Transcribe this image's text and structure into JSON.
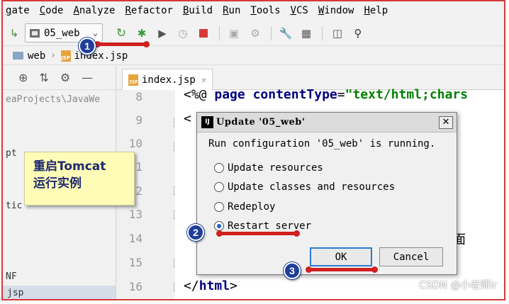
{
  "menubar": {
    "items": [
      "gate",
      "Code",
      "Analyze",
      "Refactor",
      "Build",
      "Run",
      "Tools",
      "VCS",
      "Window",
      "Help"
    ]
  },
  "toolbar": {
    "run_config": "05_web",
    "icons": [
      "rerun-icon",
      "debug-icon",
      "coverage-icon",
      "profile-icon",
      "stop-icon",
      "build-icon",
      "deploy-icon",
      "settings-wrench-icon",
      "project-structure-icon",
      "terminal-icon",
      "search-icon"
    ]
  },
  "breadcrumb": {
    "folder": "web",
    "file": "index.jsp"
  },
  "sidebar": {
    "lines": [
      "eaProjects\\JavaWe",
      "pt",
      "tic",
      "NF",
      "jsp"
    ]
  },
  "editor": {
    "tab_label": "index.jsp",
    "line_numbers": [
      "8",
      "9",
      "10",
      "11",
      "12",
      "13",
      "14",
      "15",
      "16"
    ],
    "line8_prefix": "<%@ ",
    "line8_kw1": "page",
    "line8_kw2": "contentType",
    "line8_eq": "=",
    "line8_str": "\"text/html;chars",
    "line9": "<",
    "line14_tail": "面",
    "line16_open": "</",
    "line16_tag": "html",
    "line16_close": ">"
  },
  "note": {
    "line1": "重启Tomcat",
    "line2": "运行实例"
  },
  "dialog": {
    "title": "Update '05_web'",
    "message": "Run configuration '05_web' is running.",
    "options": [
      "Update resources",
      "Update classes and resources",
      "Redeploy",
      "Restart server"
    ],
    "selected": "Restart server",
    "ok_label": "OK",
    "cancel_label": "Cancel"
  },
  "annotations": {
    "badges": [
      "1",
      "2",
      "3"
    ],
    "color": "#d21f1f",
    "badge_color": "#1f3f9a"
  },
  "watermark": "CSDN @小老师ir"
}
